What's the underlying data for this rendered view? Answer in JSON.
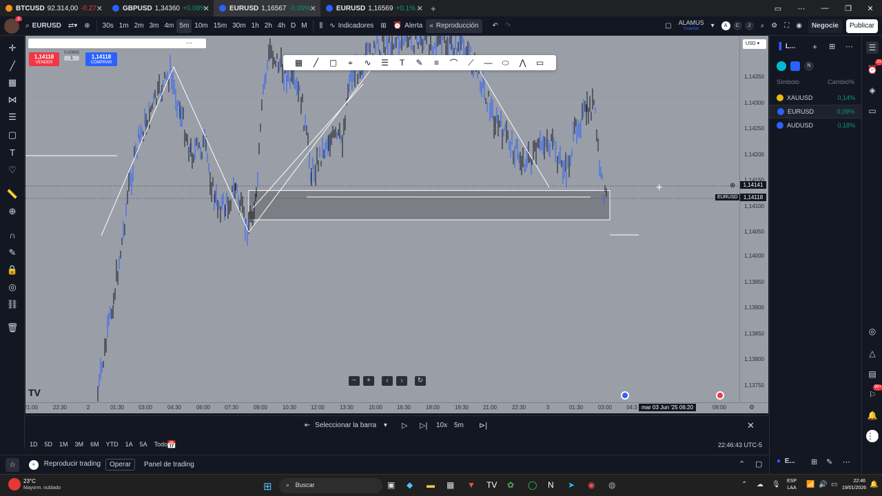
{
  "browser": {
    "tabs": [
      {
        "symbol": "BTCUSD",
        "price": "92.314,00",
        "change": "-0.27",
        "favicon_color": "#f7931a",
        "dir": "neg"
      },
      {
        "symbol": "GBPUSD",
        "price": "1,34360",
        "change": "+0.08%",
        "favicon_color": "#2962ff",
        "dir": "pos"
      },
      {
        "symbol": "EURUSD",
        "price": "1,16567",
        "change": "-0.09%",
        "favicon_color": "#2962ff",
        "dir": "pos"
      },
      {
        "symbol": "EURUSD",
        "price": "1,16569",
        "change": "+0.1% /",
        "favicon_color": "#2962ff",
        "dir": "pos"
      }
    ],
    "new_tab": "+"
  },
  "toolbar": {
    "symbol": "EURUSD",
    "avatar_badge": "2",
    "intervals": [
      "30s",
      "1m",
      "2m",
      "3m",
      "4m",
      "5m",
      "10m",
      "15m",
      "30m",
      "1h",
      "2h",
      "4h",
      "D",
      "M"
    ],
    "active_interval": "5m",
    "indicators": "Indicadores",
    "alert": "Alerta",
    "replay": "Reproducción",
    "layout_name": "ALAMUS",
    "layout_sub": "Guardar",
    "trade": "Negocie",
    "publish": "Publicar",
    "letters": [
      "A",
      "C",
      "J"
    ]
  },
  "order": {
    "sell_price": "1,14118",
    "sell_label": "VENDER",
    "buy_price": "1,14118",
    "buy_label": "COMPRAR",
    "spread": "0.00000",
    "qty": "1"
  },
  "chart": {
    "currency": "USD",
    "symbol_label": "EURUSD",
    "crosshair_price": "1,14141",
    "last_price": "1,14118",
    "cursor_time": "mar 03 Jun '25  06:20",
    "price_ticks": [
      "1,14350",
      "1,14300",
      "1,14250",
      "1,14200",
      "1,14150",
      "1,14100",
      "1,14050",
      "1,14000",
      "1,13950",
      "1,13900",
      "1,13850",
      "1,13800",
      "1,13750"
    ],
    "time_ticks": [
      "21:00",
      "22:30",
      "2",
      "01:30",
      "03:00",
      "04:30",
      "06:00",
      "07:30",
      "09:00",
      "10:30",
      "12:00",
      "13:30",
      "15:00",
      "16:30",
      "18:00",
      "19:30",
      "21:00",
      "22:30",
      "3",
      "01:30",
      "03:00",
      "04:3",
      "09:00"
    ],
    "logo": "TV"
  },
  "chart_data": {
    "type": "candlestick",
    "title": "",
    "xlabel": "",
    "ylabel": "",
    "ylim": [
      1.137,
      1.1442
    ],
    "zone": {
      "top": 1.1411,
      "bottom": 1.1405,
      "from": "09:00",
      "to": "03:00"
    },
    "horizontal_levels": [
      1.1422,
      1.14141,
      1.14118,
      1.1405
    ]
  },
  "replay": {
    "select_bar": "Seleccionar la barra",
    "speed": "10x",
    "interval": "5m"
  },
  "ranges": {
    "items": [
      "1D",
      "5D",
      "1M",
      "3M",
      "6M",
      "YTD",
      "1A",
      "5A",
      "Todos"
    ],
    "clock": "22:46:43 UTC-5"
  },
  "bottom": {
    "replay_trading": "Reproducir trading",
    "operate": "Operar",
    "trading_panel": "Panel de trading"
  },
  "watchlist": {
    "title": "L...",
    "col_symbol": "Símbolo",
    "col_change": "Cambio%",
    "rows": [
      {
        "symbol": "XAUUSD",
        "change": "0,14%",
        "icon_color": "#f0b90b"
      },
      {
        "symbol": "EURUSD",
        "change": "0,09%",
        "icon_color": "#2962ff"
      },
      {
        "symbol": "AUDUSD",
        "change": "0,18%",
        "icon_color": "#2962ff"
      }
    ],
    "footer_label": "E..."
  },
  "right_badges": {
    "notif": "33",
    "chat": "99+"
  },
  "taskbar": {
    "weather_temp": "23°C",
    "weather_desc": "Mayorm. nublado",
    "search": "Buscar",
    "lang": "ESP",
    "lang_sub": "LAA",
    "time": "22:46",
    "date": "19/01/2026"
  }
}
